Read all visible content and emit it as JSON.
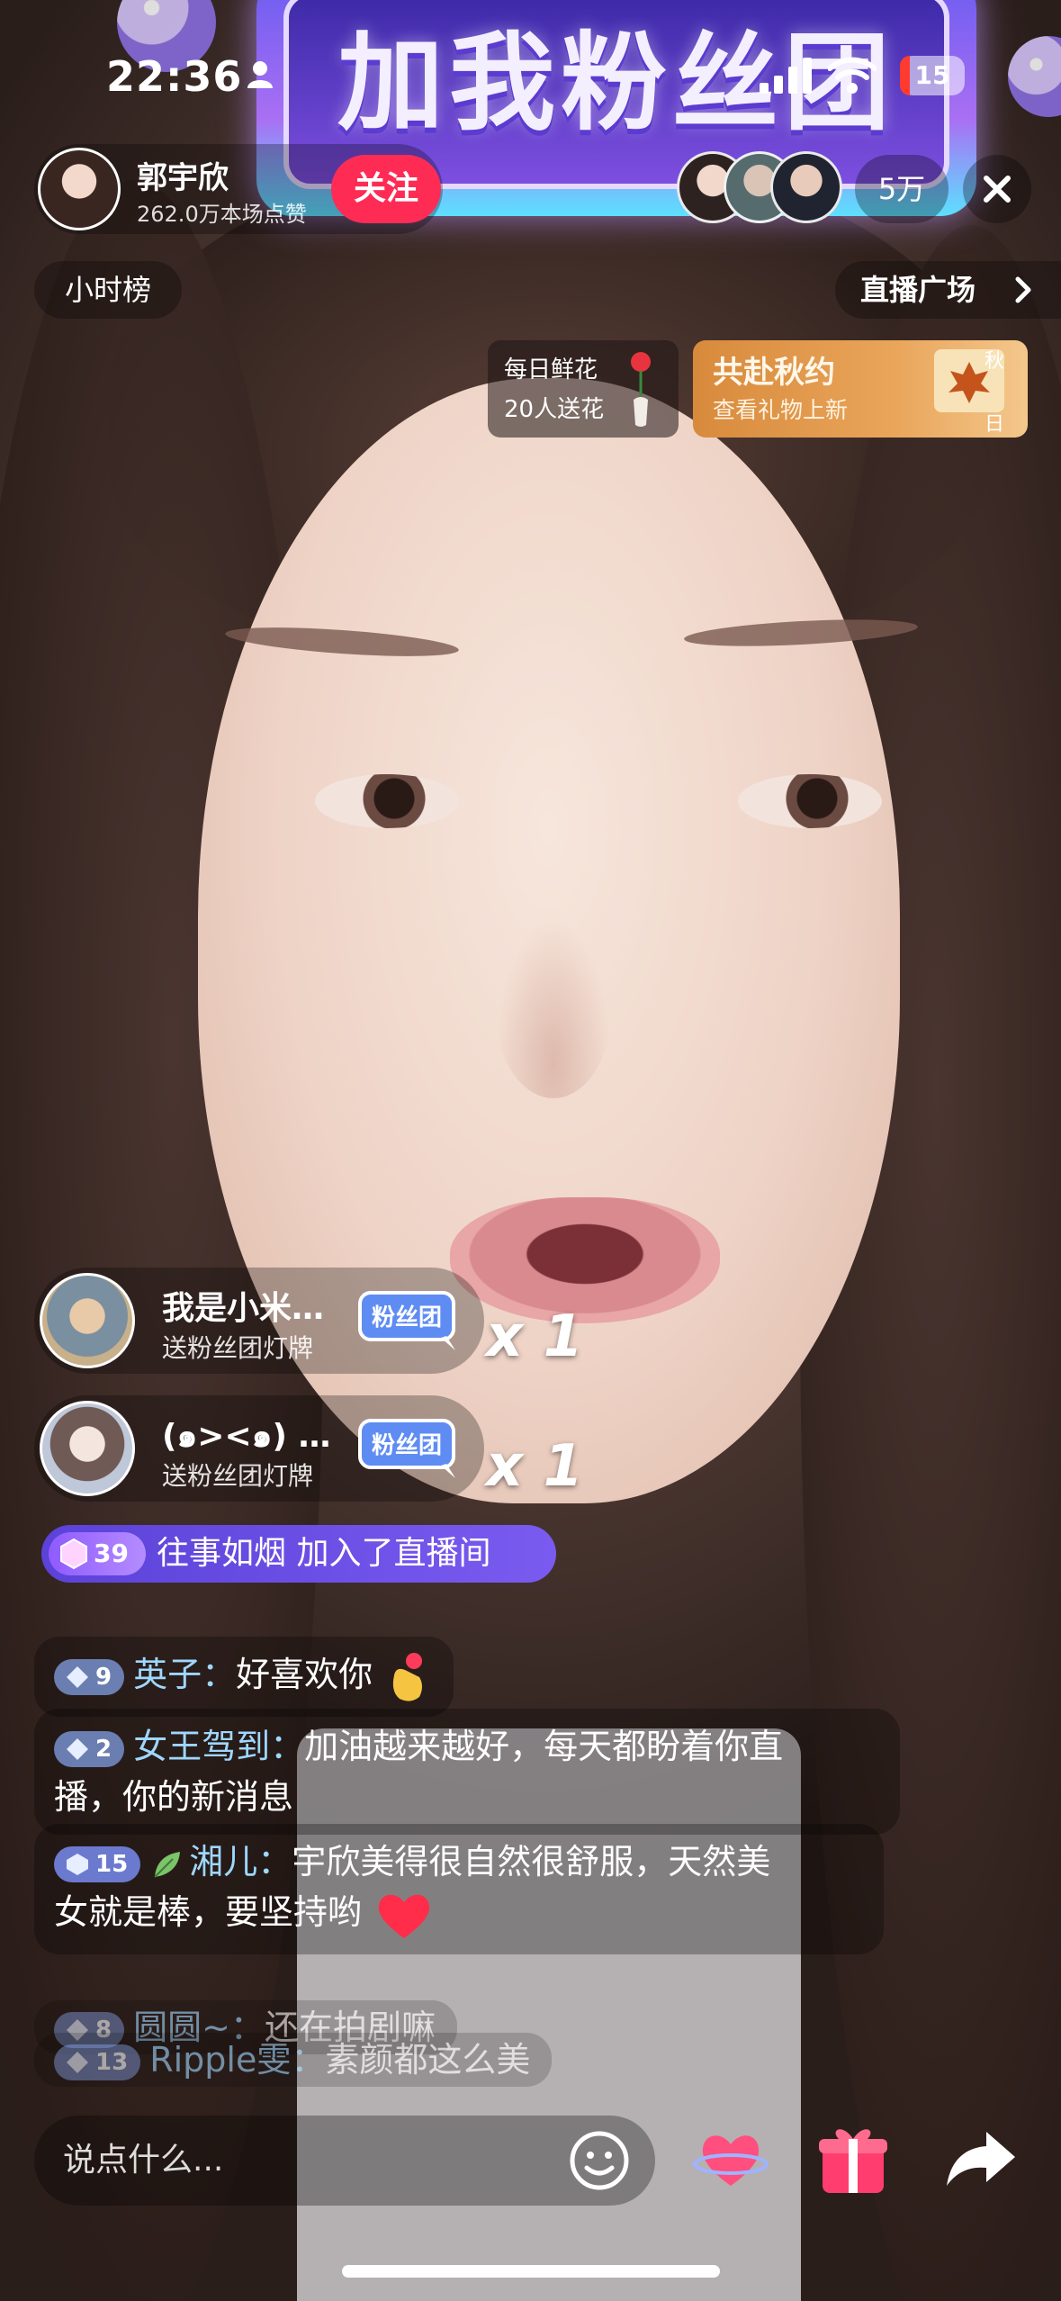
{
  "status_bar": {
    "time": "22:36",
    "battery": "15",
    "battery_level": 0.15
  },
  "banner": {
    "text": "加我粉丝团"
  },
  "anchor": {
    "name": "郭宇欣",
    "likes": "262.0万本场点赞",
    "follow_label": "关注"
  },
  "viewers": {
    "count": "5万"
  },
  "nav": {
    "rank_label": "小时榜",
    "plaza_label": "直播广场"
  },
  "flower_card": {
    "line1": "每日鲜花",
    "line2": "20人送花"
  },
  "autumn_card": {
    "title": "共赴秋约",
    "subtitle": "查看礼物上新",
    "badge_top": "秋",
    "badge_bottom": "日"
  },
  "gifts": [
    {
      "name": "我是小米…",
      "desc": "送粉丝团灯牌",
      "badge": "粉丝团",
      "count": "x 1"
    },
    {
      "name": "(๑><๑) …",
      "desc": "送粉丝团灯牌",
      "badge": "粉丝团",
      "count": "x 1"
    }
  ],
  "join": {
    "level": "39",
    "text": "往事如烟 加入了直播间"
  },
  "comments": [
    {
      "level": "9",
      "name": "英子：",
      "text": "好喜欢你"
    },
    {
      "level": "2",
      "name": "女王驾到：",
      "text": "加油越来越好，每天都盼着你直",
      "text2": "播，你的新消息"
    },
    {
      "level": "15",
      "name": "湘儿：",
      "text": "宇欣美得很自然很舒服，天然美",
      "text2": "女就是棒，要坚持哟"
    },
    {
      "level": "8",
      "name": "圆圆~：",
      "text": "还在拍剧嘛"
    },
    {
      "level": "13",
      "name": "Ripple雯：",
      "text": "素颜都这么美"
    }
  ],
  "bottom_bar": {
    "input_placeholder": "说点什么..."
  },
  "colors": {
    "follow": "#fe2c55",
    "comment_name": "#9fd7ff",
    "join_bg": "#5b42d8",
    "autumn": "#e9a55a"
  }
}
